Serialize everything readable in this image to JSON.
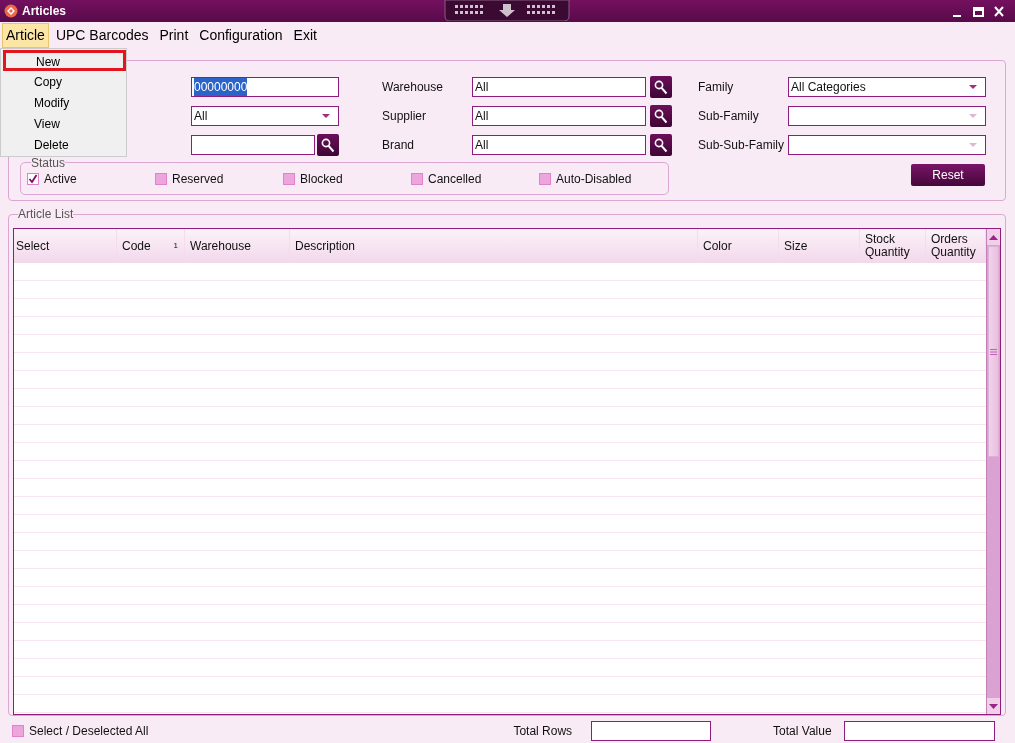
{
  "window": {
    "title": "Articles"
  },
  "menu": [
    {
      "label": "Article",
      "selected": true
    },
    {
      "label": "UPC Barcodes",
      "selected": false
    },
    {
      "label": "Print",
      "selected": false
    },
    {
      "label": "Configuration",
      "selected": false
    },
    {
      "label": "Exit",
      "selected": false
    }
  ],
  "open_menu": {
    "items": [
      {
        "label": "New",
        "highlighted": true
      },
      {
        "label": "Copy",
        "highlighted": false
      },
      {
        "label": "Modify",
        "highlighted": false
      },
      {
        "label": "View",
        "highlighted": false
      },
      {
        "label": "Delete",
        "highlighted": false
      }
    ]
  },
  "filters": {
    "rows": [
      {
        "first": {
          "kind": "text",
          "value": "00000000",
          "selected_text": true
        },
        "middle": {
          "label": "Warehouse",
          "value": "All"
        },
        "right": {
          "label": "Family",
          "value": "All Categories",
          "disabled": false
        }
      },
      {
        "first": {
          "kind": "select",
          "value": "All"
        },
        "middle": {
          "label": "Supplier",
          "value": "All"
        },
        "right": {
          "label": "Sub-Family",
          "disabled": true
        }
      },
      {
        "first": {
          "kind": "search"
        },
        "middle": {
          "label": "Brand",
          "value": "All"
        },
        "right": {
          "label": "Sub-Sub-Family",
          "disabled": true
        }
      }
    ]
  },
  "status": {
    "title": "Status",
    "options": [
      {
        "label": "Active",
        "checked": true
      },
      {
        "label": "Reserved",
        "checked": false
      },
      {
        "label": "Blocked",
        "checked": false
      },
      {
        "label": "Cancelled",
        "checked": false
      },
      {
        "label": "Auto-Disabled",
        "checked": false
      }
    ]
  },
  "reset_button": "Reset",
  "article_list": {
    "title": "Article List",
    "columns": [
      {
        "label": "Select"
      },
      {
        "label": "Code",
        "sort_order": "1"
      },
      {
        "label": "Warehouse"
      },
      {
        "label": "Description"
      },
      {
        "label": "Color"
      },
      {
        "label": "Size"
      },
      {
        "label": "Stock Quantity"
      },
      {
        "label": "Orders Quantity"
      }
    ]
  },
  "footer": {
    "select_all": {
      "label": "Select / Deselected All",
      "checked": false
    },
    "total_rows": {
      "label": "Total Rows"
    },
    "total_value": {
      "label": "Total Value"
    }
  }
}
